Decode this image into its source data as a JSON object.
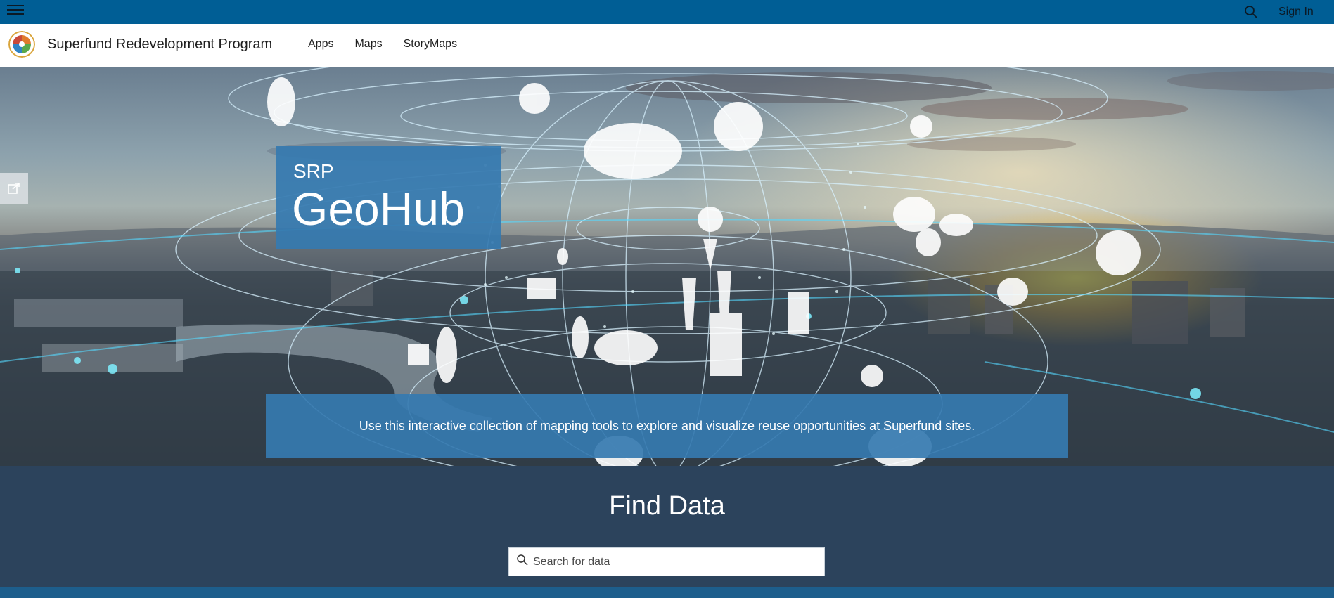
{
  "topbar": {
    "menu_icon": "hamburger-menu-icon",
    "search_icon": "search-icon",
    "signin_label": "Sign In",
    "background": "#005e95"
  },
  "header": {
    "logo_icon": "superfund-redevelopment-logo",
    "site_title": "Superfund Redevelopment Program",
    "nav": [
      {
        "label": "Apps"
      },
      {
        "label": "Maps"
      },
      {
        "label": "StoryMaps"
      }
    ]
  },
  "hero": {
    "share_icon": "share-icon",
    "title_small": "SRP",
    "title_big": "GeoHub",
    "description": "Use this interactive collection of mapping tools to explore and visualize reuse opportunities at Superfund sites.",
    "box_color": "#357ab0"
  },
  "find_data": {
    "title": "Find Data",
    "search_placeholder": "Search for data",
    "search_icon": "search-icon",
    "background": "#2c435c"
  }
}
